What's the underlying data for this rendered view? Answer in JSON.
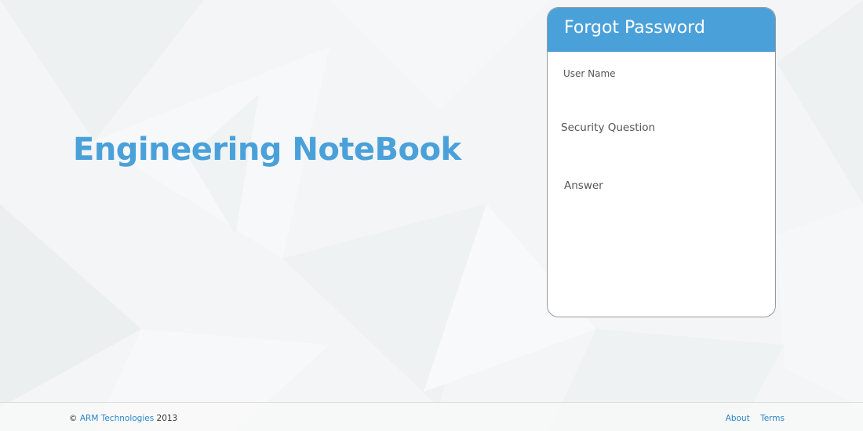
{
  "app": {
    "title": "Engineering NoteBook"
  },
  "form": {
    "title": "Forgot Password",
    "fields": {
      "username_label": "User Name",
      "username_value": "",
      "question_label": "Security Question",
      "question_value": "",
      "answer_label": "Answer",
      "answer_value": ""
    }
  },
  "footer": {
    "copyright_symbol": "©",
    "company": "ARM Technologies",
    "year": "2013",
    "links": {
      "about": "About",
      "terms": "Terms"
    }
  },
  "colors": {
    "accent": "#4aa1da",
    "link": "#2b86c7",
    "background": "#f3f5f6"
  }
}
